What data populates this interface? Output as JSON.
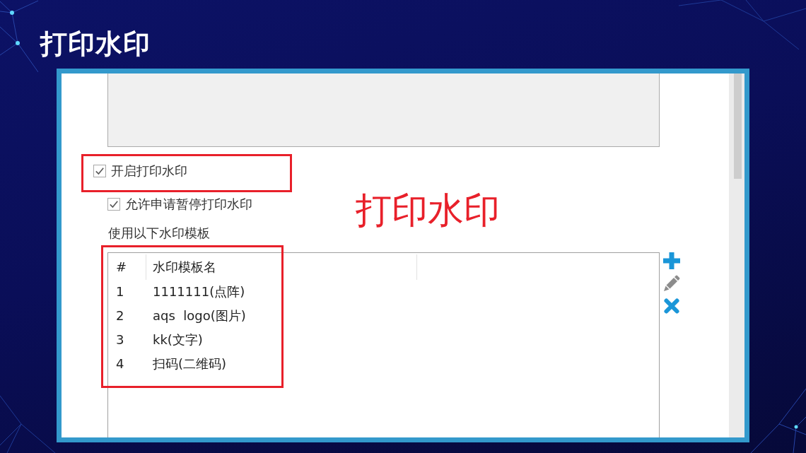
{
  "slide": {
    "title": "打印水印"
  },
  "annotation": {
    "text": "打印水印"
  },
  "settings": {
    "options": [
      {
        "label": "开启打印水印",
        "checked": true,
        "highlighted": true,
        "children": [
          {
            "label": "允许申请暂停打印水印",
            "checked": true,
            "highlighted": false
          }
        ]
      }
    ],
    "templates": {
      "label": "使用以下水印模板",
      "highlighted": true,
      "columns": [
        "#",
        "水印模板名"
      ],
      "rows": [
        {
          "index": "1",
          "name": "1111111(点阵)"
        },
        {
          "index": "2",
          "name": "aqs  logo(图片)"
        },
        {
          "index": "3",
          "name": "kk(文字)"
        },
        {
          "index": "4",
          "name": "扫码(二维码)"
        }
      ],
      "actions": [
        {
          "kind": "add",
          "disabled": false
        },
        {
          "kind": "edit",
          "disabled": true
        },
        {
          "kind": "delete",
          "disabled": false
        }
      ]
    }
  }
}
